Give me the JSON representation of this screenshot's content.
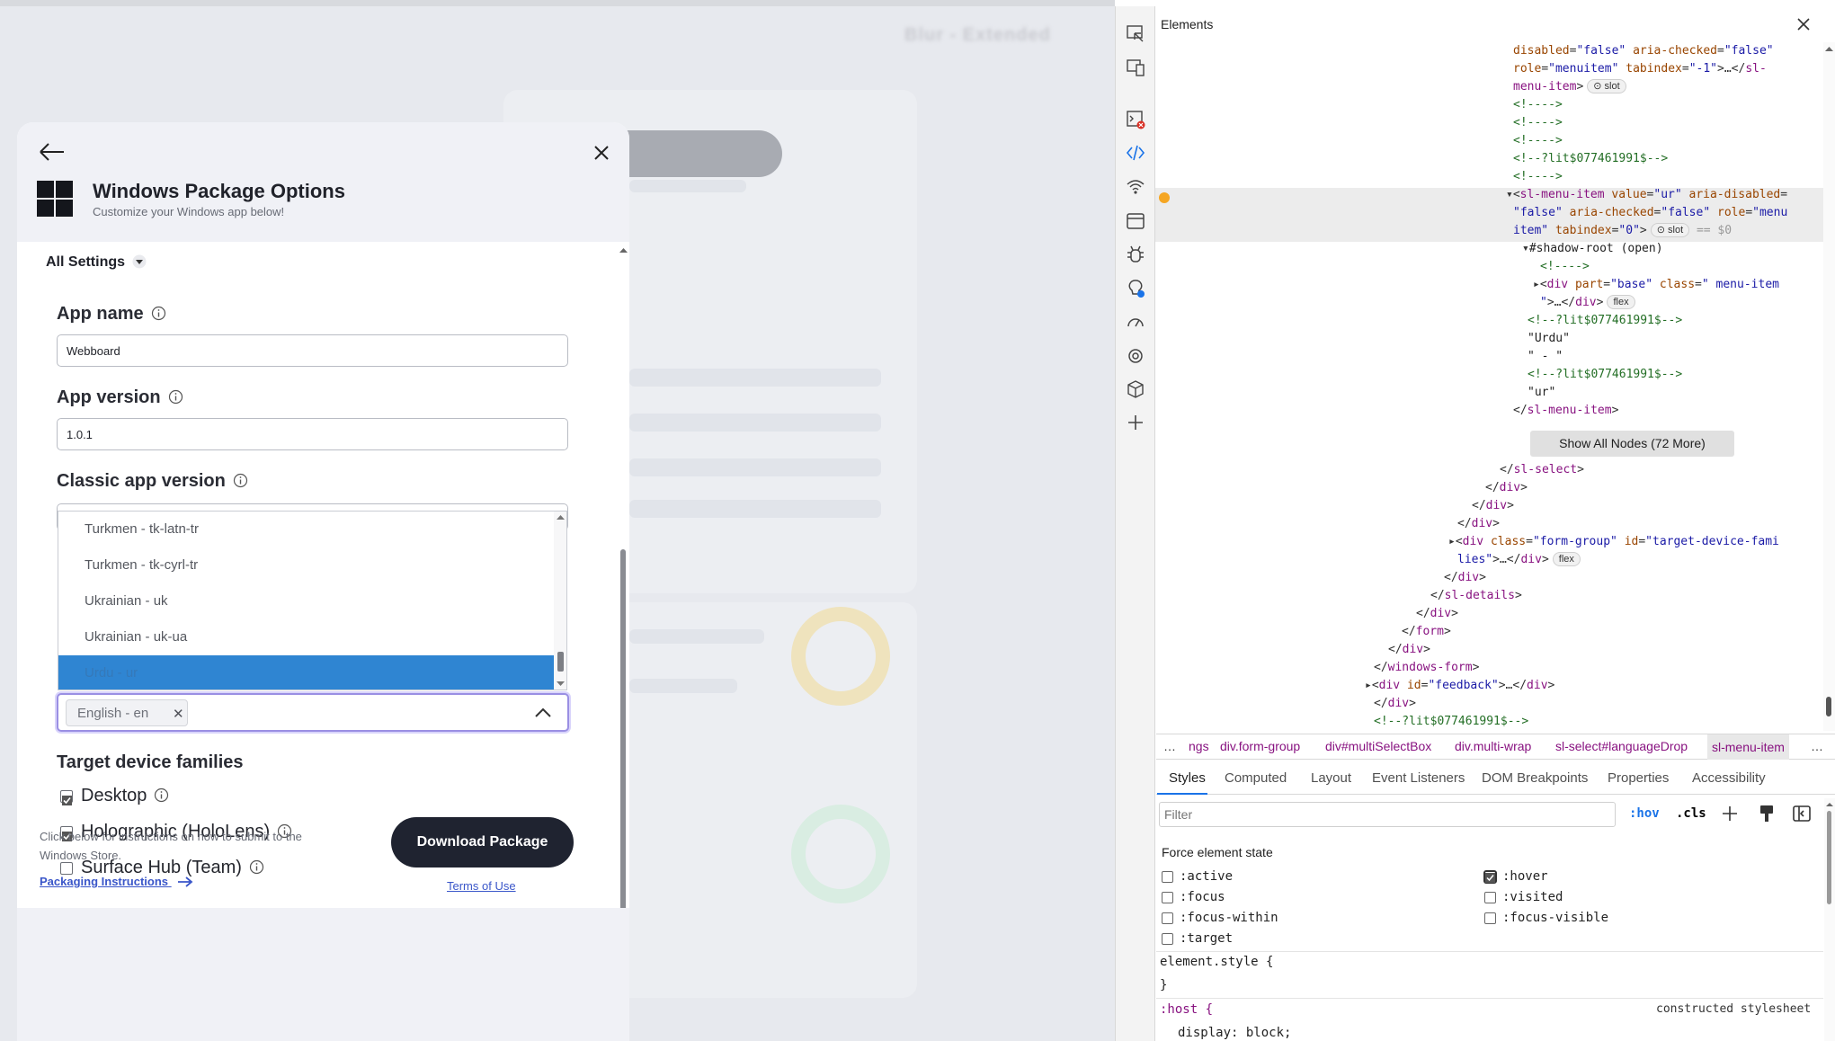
{
  "background": {
    "brand_blurred": "Blur - Extended"
  },
  "modal": {
    "title": "Windows Package Options",
    "subtitle": "Customize your Windows app below!",
    "all_settings": "All Settings",
    "app_name": {
      "label": "App name",
      "value": "Webboard"
    },
    "app_version": {
      "label": "App version",
      "value": "1.0.1"
    },
    "classic_version": {
      "label": "Classic app version"
    },
    "language_dropdown": {
      "options": [
        "Turkmen - tk-latn-tr",
        "Turkmen - tk-cyrl-tr",
        "Ukrainian - uk",
        "Ukrainian - uk-ua",
        "Urdu - ur"
      ],
      "selected_index": 4
    },
    "language_select": {
      "tag": "English - en"
    },
    "target_families": {
      "label": "Target device families",
      "items": [
        {
          "label": "Desktop",
          "checked": true
        },
        {
          "label": "Holographic (HoloLens)",
          "checked": true
        },
        {
          "label": "Surface Hub (Team)",
          "checked": false
        }
      ]
    },
    "footer": {
      "text": "Click below for instructions on how to submit to the Windows Store.",
      "link": "Packaging Instructions",
      "download": "Download Package",
      "terms": "Terms of Use"
    }
  },
  "devtools": {
    "title": "Elements",
    "show_all": "Show All Nodes (72 More)",
    "crumbs": [
      "…",
      "ngs",
      "div.form-group",
      "div#multiSelectBox",
      "div.multi-wrap",
      "sl-select#languageDrop",
      "sl-menu-item",
      "…"
    ],
    "tabs": [
      "Styles",
      "Computed",
      "Layout",
      "Event Listeners",
      "DOM Breakpoints",
      "Properties",
      "Accessibility"
    ],
    "filter_placeholder": "Filter",
    "hov": ":hov",
    "cls": ".cls",
    "force_state": "Force element state",
    "states_left": [
      ":active",
      ":focus",
      ":focus-within",
      ":target"
    ],
    "states_right": [
      ":hover",
      ":visited",
      ":focus-visible"
    ],
    "hover_checked": true,
    "element_style": "element.style {",
    "close_brace": "}",
    "host_rule": ":host {",
    "constructed": "constructed stylesheet",
    "display_decl": "display: block;"
  }
}
